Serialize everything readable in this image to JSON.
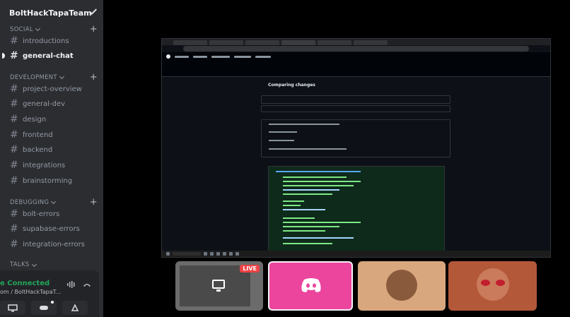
{
  "server": {
    "name": "BoltHackTapaTeam"
  },
  "categories": {
    "social": "SOCIAL",
    "development": "DEVELOPMENT",
    "debugging": "DEBUGGING",
    "talks": "TALKS"
  },
  "channels": {
    "social": [
      "introductions",
      "general-chat"
    ],
    "development": [
      "project-overview",
      "general-dev",
      "design",
      "frontend",
      "backend",
      "integrations",
      "brainstorming"
    ],
    "debugging": [
      "bolt-errors",
      "supabase-errors",
      "integration-errors"
    ]
  },
  "voice": {
    "status": "e Connected",
    "location": "om / BoltHackTapaT..."
  },
  "screenshare": {
    "page_title": "Comparing changes"
  },
  "tiles": {
    "live_badge": "LIVE"
  },
  "colors": {
    "sidebar_bg": "#2b2d31",
    "connected_green": "#23a55a",
    "live_red": "#ed4245",
    "discord_pink": "#eb459e"
  }
}
